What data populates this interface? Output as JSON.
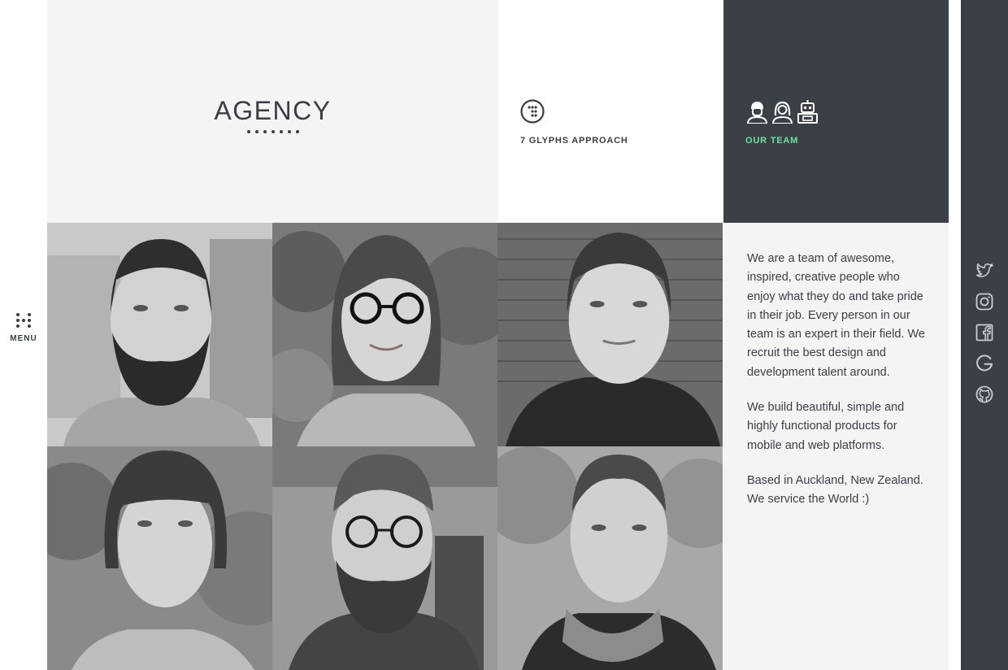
{
  "menu": {
    "label": "MENU",
    "icon": "grid-dots-icon"
  },
  "header": {
    "agency_title": "AGENCY",
    "glyphs_label": "7 GLYPHS APPROACH",
    "glyphs_icon": "seven-dots-circle-icon",
    "team_label": "OUR TEAM",
    "team_icons": [
      "bearded-person-icon",
      "woman-icon",
      "robot-icon"
    ]
  },
  "team_photos": [
    {
      "name": "bearded-man-portrait"
    },
    {
      "name": "woman-glasses-portrait"
    },
    {
      "name": "young-man-portrait"
    },
    {
      "name": "woman-bangs-portrait"
    },
    {
      "name": "man-glasses-beard-portrait"
    },
    {
      "name": "man-scarf-portrait"
    }
  ],
  "about": {
    "paragraph_1": "We are a team of awesome, inspired, creative people who enjoy what they do and take pride in their job. Every person in our team is an expert in their field. We recruit the best design and development talent around.",
    "paragraph_2": "We build beautiful, simple and highly functional products for mobile and web platforms.",
    "paragraph_3": "Based in Auckland, New Zealand. We service the World :)"
  },
  "social": [
    "twitter-icon",
    "instagram-icon",
    "facebook-icon",
    "google-icon",
    "github-icon"
  ],
  "colors": {
    "accent": "#6fe0a1",
    "dark": "#3b4047",
    "light": "#f4f4f4"
  }
}
